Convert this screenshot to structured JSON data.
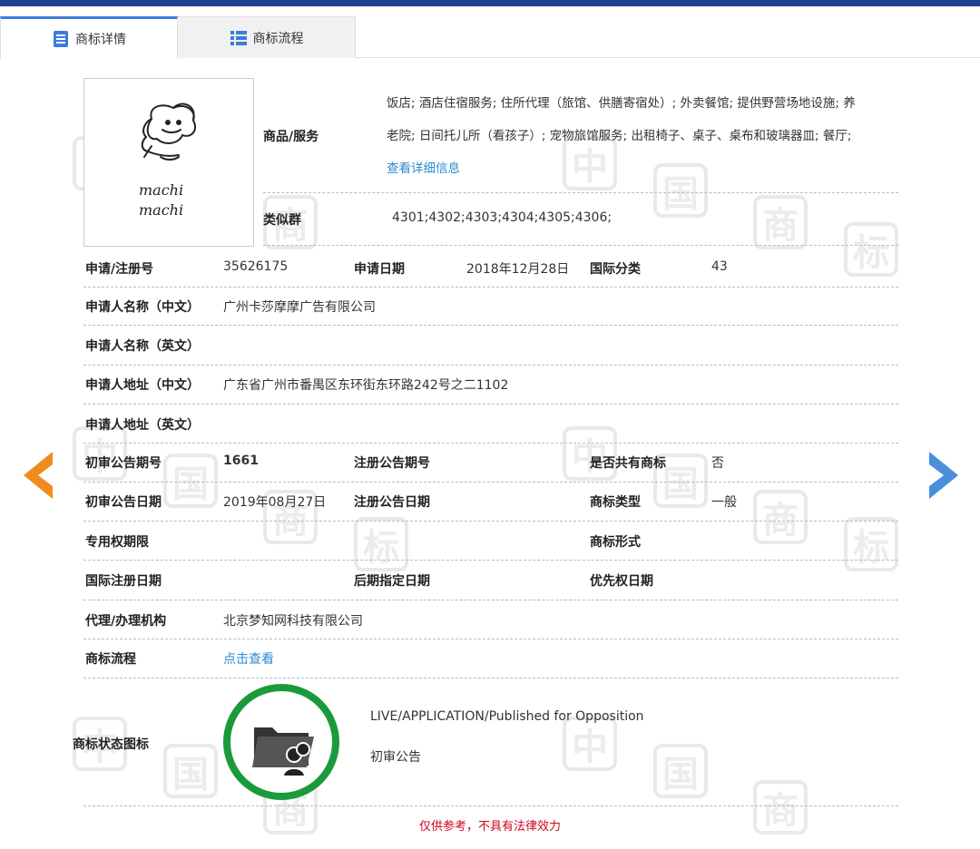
{
  "tabs": [
    {
      "label": "商标详情",
      "active": true
    },
    {
      "label": "商标流程",
      "active": false
    }
  ],
  "logo": {
    "line1": "machi",
    "line2": "machi"
  },
  "goods": {
    "label": "商品/服务",
    "line1": "饭店; 酒店住宿服务; 住所代理（旅馆、供膳寄宿处）; 外卖餐馆; 提供野营场地设施; 养",
    "line2": "老院; 日间托儿所（看孩子）; 宠物旅馆服务; 出租椅子、桌子、桌布和玻璃器皿; 餐厅;",
    "more_link": "查看详细信息"
  },
  "similar": {
    "label": "类似群",
    "value": "4301;4302;4303;4304;4305;4306;"
  },
  "fields": {
    "reg_no_label": "申请/注册号",
    "reg_no": "35626175",
    "apply_date_label": "申请日期",
    "apply_date": "2018年12月28日",
    "intl_class_label": "国际分类",
    "intl_class": "43",
    "applicant_cn_label": "申请人名称（中文）",
    "applicant_cn": "广州卡莎摩摩广告有限公司",
    "applicant_en_label": "申请人名称（英文）",
    "applicant_en": "",
    "address_cn_label": "申请人地址（中文）",
    "address_cn": "广东省广州市番禺区东环街东环路242号之二1102",
    "address_en_label": "申请人地址（英文）",
    "address_en": "",
    "prelim_no_label": "初审公告期号",
    "prelim_no": "1661",
    "reg_pub_no_label": "注册公告期号",
    "reg_pub_no": "",
    "shared_label": "是否共有商标",
    "shared": "否",
    "prelim_date_label": "初审公告日期",
    "prelim_date": "2019年08月27日",
    "reg_pub_date_label": "注册公告日期",
    "reg_pub_date": "",
    "tm_type_label": "商标类型",
    "tm_type": "一般",
    "exclusive_label": "专用权期限",
    "exclusive": "",
    "tm_form_label": "商标形式",
    "tm_form": "",
    "intl_reg_date_label": "国际注册日期",
    "intl_reg_date": "",
    "later_date_label": "后期指定日期",
    "later_date": "",
    "priority_date_label": "优先权日期",
    "priority_date": "",
    "agent_label": "代理/办理机构",
    "agent": "北京梦知网科技有限公司",
    "flow_label": "商标流程",
    "flow_link": "点击查看",
    "status_icon_label": "商标状态图标",
    "status_en": "LIVE/APPLICATION/Published for Opposition",
    "status_cn": "初审公告"
  },
  "disclaimer": "仅供参考，不具有法律效力",
  "colors": {
    "accent": "#3b7dd8",
    "link": "#2a8bd0",
    "status_ring": "#1a9a3c",
    "prev_arrow": "#f08c1e",
    "next_arrow": "#4a90d9",
    "disclaimer": "#d0021b"
  }
}
